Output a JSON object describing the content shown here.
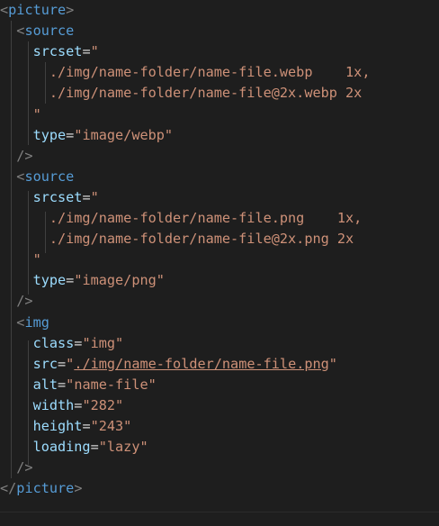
{
  "code": {
    "lines": [
      [
        {
          "t": "punc",
          "v": "<"
        },
        {
          "t": "tag",
          "v": "picture"
        },
        {
          "t": "punc",
          "v": ">"
        }
      ],
      [
        {
          "t": "punc",
          "v": "  <"
        },
        {
          "t": "tag",
          "v": "source"
        }
      ],
      [
        {
          "t": "attr",
          "v": "    srcset"
        },
        {
          "t": "eq",
          "v": "="
        },
        {
          "t": "str",
          "v": "\""
        }
      ],
      [
        {
          "t": "str",
          "v": "      ./img/name-folder/name-file.webp    1x,"
        }
      ],
      [
        {
          "t": "str",
          "v": "      ./img/name-folder/name-file@2x.webp 2x"
        }
      ],
      [
        {
          "t": "str",
          "v": "    \""
        }
      ],
      [
        {
          "t": "attr",
          "v": "    type"
        },
        {
          "t": "eq",
          "v": "="
        },
        {
          "t": "str",
          "v": "\"image/webp\""
        }
      ],
      [
        {
          "t": "punc",
          "v": "  />"
        }
      ],
      [
        {
          "t": "punc",
          "v": "  <"
        },
        {
          "t": "tag",
          "v": "source"
        }
      ],
      [
        {
          "t": "attr",
          "v": "    srcset"
        },
        {
          "t": "eq",
          "v": "="
        },
        {
          "t": "str",
          "v": "\""
        }
      ],
      [
        {
          "t": "str",
          "v": "      ./img/name-folder/name-file.png    1x,"
        }
      ],
      [
        {
          "t": "str",
          "v": "      ./img/name-folder/name-file@2x.png 2x"
        }
      ],
      [
        {
          "t": "str",
          "v": "    \""
        }
      ],
      [
        {
          "t": "attr",
          "v": "    type"
        },
        {
          "t": "eq",
          "v": "="
        },
        {
          "t": "str",
          "v": "\"image/png\""
        }
      ],
      [
        {
          "t": "punc",
          "v": "  />"
        }
      ],
      [
        {
          "t": "punc",
          "v": "  <"
        },
        {
          "t": "tag",
          "v": "img"
        }
      ],
      [
        {
          "t": "attr",
          "v": "    class"
        },
        {
          "t": "eq",
          "v": "="
        },
        {
          "t": "str",
          "v": "\"img\""
        }
      ],
      [
        {
          "t": "attr",
          "v": "    src"
        },
        {
          "t": "eq",
          "v": "="
        },
        {
          "t": "str",
          "v": "\""
        },
        {
          "t": "str",
          "v": "./img/name-folder/name-file.png",
          "link": true
        },
        {
          "t": "str",
          "v": "\""
        }
      ],
      [
        {
          "t": "attr",
          "v": "    alt"
        },
        {
          "t": "eq",
          "v": "="
        },
        {
          "t": "str",
          "v": "\"name-file\""
        }
      ],
      [
        {
          "t": "attr",
          "v": "    width"
        },
        {
          "t": "eq",
          "v": "="
        },
        {
          "t": "str",
          "v": "\"282\""
        }
      ],
      [
        {
          "t": "attr",
          "v": "    height"
        },
        {
          "t": "eq",
          "v": "="
        },
        {
          "t": "str",
          "v": "\"243\""
        }
      ],
      [
        {
          "t": "attr",
          "v": "    loading"
        },
        {
          "t": "eq",
          "v": "="
        },
        {
          "t": "str",
          "v": "\"lazy\""
        }
      ],
      [
        {
          "t": "punc",
          "v": "  />"
        }
      ],
      [
        {
          "t": "punc",
          "v": "</"
        },
        {
          "t": "tag",
          "v": "picture"
        },
        {
          "t": "punc",
          "v": ">"
        }
      ]
    ]
  },
  "colors": {
    "background": "#1e1e1e",
    "tag": "#569cd6",
    "punctuation": "#808080",
    "attribute": "#9cdcfe",
    "equals": "#d4d4d4",
    "string": "#ce9178",
    "indent_guide": "#404040"
  }
}
